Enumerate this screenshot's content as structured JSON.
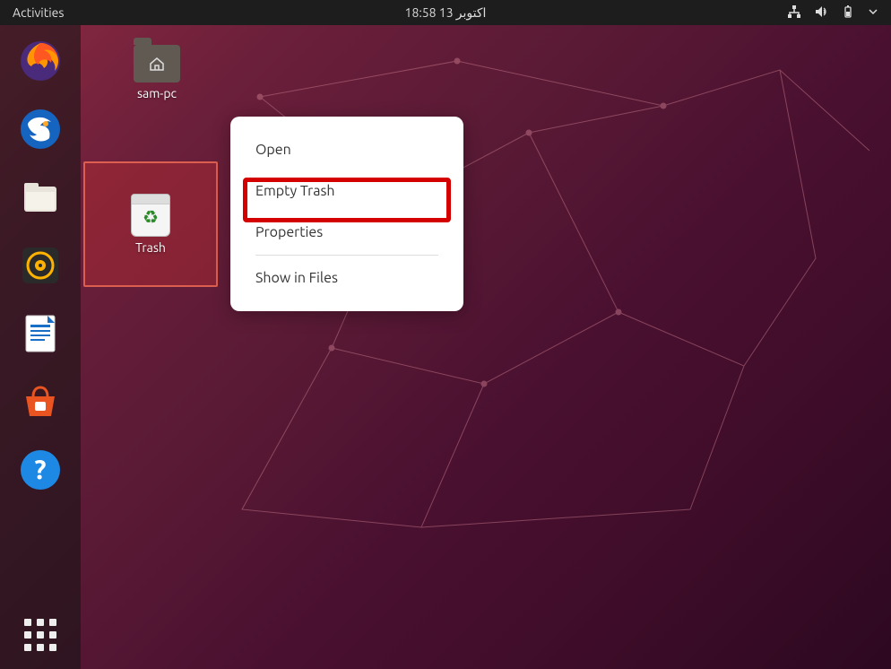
{
  "topbar": {
    "activities": "Activities",
    "datetime": "اکتوبر  13  18:58"
  },
  "dock": {
    "items": [
      {
        "name": "firefox"
      },
      {
        "name": "thunderbird"
      },
      {
        "name": "files"
      },
      {
        "name": "rhythmbox"
      },
      {
        "name": "libreoffice-writer"
      },
      {
        "name": "ubuntu-software"
      },
      {
        "name": "help"
      }
    ]
  },
  "desktop": {
    "home_label": "sam-pc",
    "trash_label": "Trash"
  },
  "context_menu": {
    "open": "Open",
    "empty": "Empty Trash",
    "properties": "Properties",
    "show_in_files": "Show in Files"
  }
}
